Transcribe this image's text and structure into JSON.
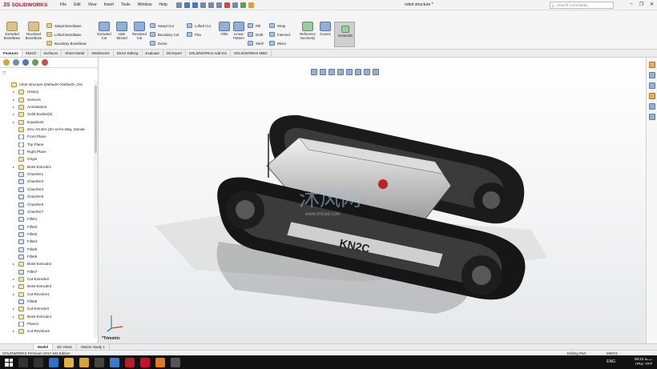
{
  "app": {
    "logo_ds": "3S",
    "logo_name": "SOLIDWORKS",
    "doc_title": "robot structure *"
  },
  "menu": [
    "File",
    "Edit",
    "View",
    "Insert",
    "Tools",
    "Window",
    "Help"
  ],
  "search": {
    "placeholder": "Search Commands"
  },
  "ribbon": {
    "extruded_boss": "Extruded Boss/Base",
    "revolved_boss": "Revolved Boss/Base",
    "swept_boss": "Swept Boss/Base",
    "lofted_boss": "Lofted Boss/Base",
    "boundary_boss": "Boundary Boss/Base",
    "extruded_cut": "Extruded Cut",
    "hole_wizard": "Hole Wizard",
    "revolved_cut": "Revolved Cut",
    "swept_cut": "Swept Cut",
    "lofted_cut": "Lofted Cut",
    "boundary_cut": "Boundary Cut",
    "dome": "Dome",
    "flex": "Flex",
    "fillet": "Fillet",
    "linear_pattern": "Linear Pattern",
    "rib": "Rib",
    "draft": "Draft",
    "shell": "Shell",
    "wrap": "Wrap",
    "intersect": "Intersect",
    "mirror": "Mirror",
    "reference_geometry": "Reference Geometry",
    "curves": "Curves",
    "instant3d": "Instant3D"
  },
  "tabs": [
    "Features",
    "Sketch",
    "Surfaces",
    "Sheet Metal",
    "Weldments",
    "Direct Editing",
    "Evaluate",
    "DimXpert",
    "SOLIDWORKS Add-Ins",
    "SOLIDWORKS MBD"
  ],
  "tree": {
    "root": "robot structure  (Default<<Default>_Dis",
    "items": [
      "History",
      "Sensors",
      "Annotations",
      "Solid Bodies(9)",
      "Equations",
      "Zmc AG40A (Zn-4Al-0.4Mg, Zamak",
      "Front Plane",
      "Top Plane",
      "Right Plane",
      "Origin",
      "Boss-Extrude1",
      "Chamfer1",
      "Chamfer3",
      "Chamfer4",
      "Chamfer5",
      "Chamfer6",
      "Chamfer7",
      "Fillet1",
      "Fillet2",
      "Fillet3",
      "Fillet4",
      "Fillet5",
      "Fillet6",
      "Boss-Extrude2",
      "Fillet7",
      "Cut-Extrude2",
      "Boss-Extrude3",
      "Cut-Revolve1",
      "Fillet8",
      "Cut-Extrude3",
      "Boss-Extrude4",
      "Plane1",
      "Cut-Revolve4"
    ]
  },
  "viewport": {
    "view_label": "*Trimetric",
    "model_label": "KN2C",
    "watermark_text": "沐风网",
    "watermark_url": "www.mfcad.com"
  },
  "bottom_tabs": [
    "Model",
    "3D Views",
    "Motion Study 1"
  ],
  "status": {
    "left": "SOLIDWORKS Premium 2017 x64 Edition",
    "mode": "Editing Part",
    "units": "MMGS"
  },
  "taskbar": {
    "lang": "ENG",
    "time": "09:23 ب.ظ",
    "date": "۱۳۹۸/۰۲/۲۳"
  }
}
